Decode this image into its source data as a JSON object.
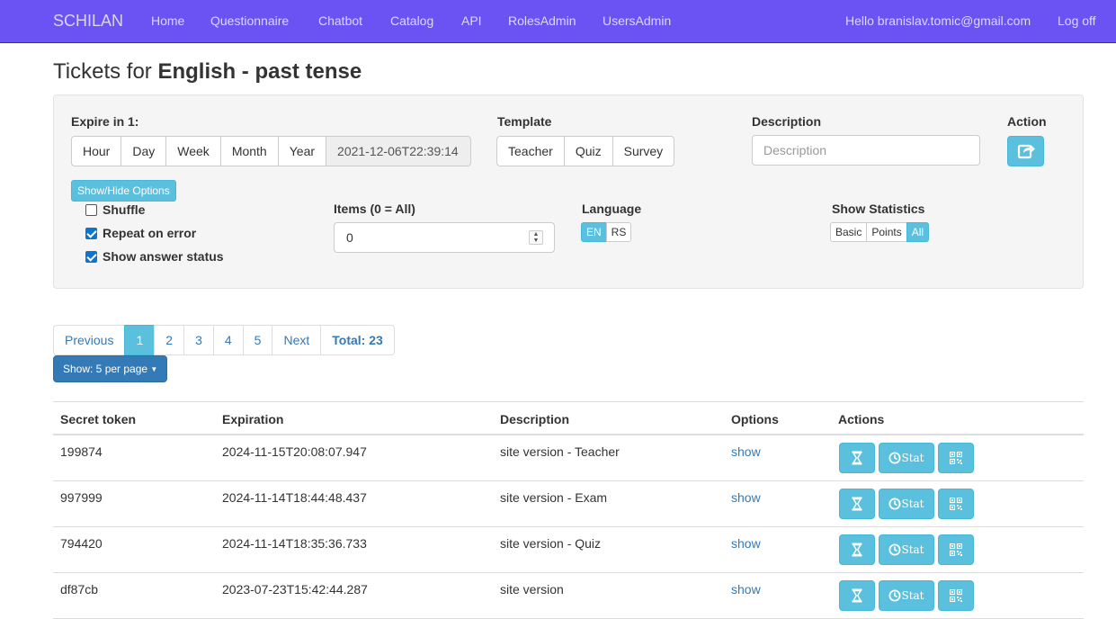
{
  "navbar": {
    "brand": "SCHILAN",
    "links": [
      "Home",
      "Questionnaire",
      "Chatbot",
      "Catalog",
      "API",
      "RolesAdmin",
      "UsersAdmin"
    ],
    "greeting": "Hello branislav.tomic@gmail.com",
    "logoff": "Log off"
  },
  "title": {
    "prefix": "Tickets for ",
    "subject": "English - past tense"
  },
  "options": {
    "expire_label": "Expire in 1:",
    "expire_buttons": [
      "Hour",
      "Day",
      "Week",
      "Month",
      "Year"
    ],
    "expire_value": "2021-12-06T22:39:14",
    "template_label": "Template",
    "template_buttons": [
      "Teacher",
      "Quiz",
      "Survey"
    ],
    "description_label": "Description",
    "description_placeholder": "Description",
    "action_label": "Action",
    "toggle_label": "Show/Hide Options",
    "checks": [
      {
        "label": "Shuffle",
        "checked": false
      },
      {
        "label": "Repeat on error",
        "checked": true
      },
      {
        "label": "Show answer status",
        "checked": true
      }
    ],
    "items_label": "Items (0 = All)",
    "items_value": "0",
    "language_label": "Language",
    "languages": [
      "EN",
      "RS"
    ],
    "language_selected": "EN",
    "stats_label": "Show Statistics",
    "stats": [
      "Basic",
      "Points",
      "All"
    ],
    "stats_selected": "All"
  },
  "pagination": {
    "previous": "Previous",
    "pages": [
      "1",
      "2",
      "3",
      "4",
      "5"
    ],
    "current": "1",
    "next": "Next",
    "total": "Total: 23",
    "page_size_label": "Show: 5 per page"
  },
  "table": {
    "headers": [
      "Secret token",
      "Expiration",
      "Description",
      "Options",
      "Actions"
    ],
    "rows": [
      {
        "token": "199874",
        "expiration": "2024-11-15T20:08:07.947",
        "description": "site version - Teacher",
        "option": "show"
      },
      {
        "token": "997999",
        "expiration": "2024-11-14T18:44:48.437",
        "description": "site version - Exam",
        "option": "show"
      },
      {
        "token": "794420",
        "expiration": "2024-11-14T18:35:36.733",
        "description": "site version - Quiz",
        "option": "show"
      },
      {
        "token": "df87cb",
        "expiration": "2023-07-23T15:42:44.287",
        "description": "site version",
        "option": "show"
      }
    ],
    "stat_button_label": "Stat"
  },
  "colors": {
    "navbar": "#6a53f2",
    "info": "#5bc0de",
    "primary": "#337ab7",
    "checkbox": "#0b75d1"
  },
  "icons": {
    "action": "share-square-icon",
    "row_actions": [
      "hourglass-icon",
      "clock-stat-icon",
      "qrcode-icon"
    ]
  }
}
